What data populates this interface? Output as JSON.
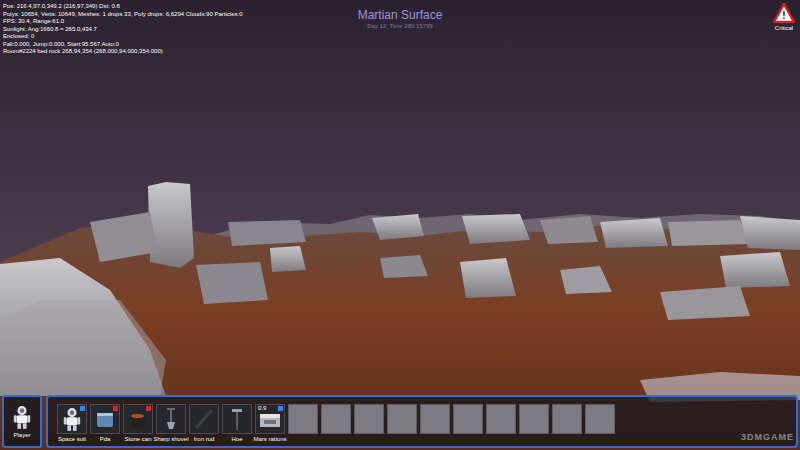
{
  "hud": {
    "debug_lines": [
      "Pos: 216.4,97.0,349.2 (216,97,349) Dst: 0.8",
      "Polys: 10654, Verts: 10649, Meshes: 1 drops 33, Poly drops: 6,6294 Clouds:90 Particles:0",
      "FPS: 30.4, Range:61.0",
      "Sunlight: Ang:1660.8 = 265.0,434.7",
      "Enclosed: 0",
      "Fall:0.000, Jump:0.000, Start:95.567 Auto:0",
      "Room#2224 bed rock 268,94,354 (268.000,94.000,354.000)"
    ],
    "location": "Martian Surface",
    "time": "Day 12, Time 289.15799",
    "alert": {
      "icon": "!",
      "label": "Critical"
    }
  },
  "player": {
    "label": "Player"
  },
  "inventory": {
    "slots": [
      {
        "kind": "suit",
        "label": "Space suit",
        "badge": "#3b82f6"
      },
      {
        "kind": "pda",
        "label": "Pda",
        "badge": "#dc2626"
      },
      {
        "kind": "can",
        "label": "Stone can",
        "badge": "#dc2626"
      },
      {
        "kind": "shovel",
        "label": "Sharp shovel"
      },
      {
        "kind": "rod",
        "label": "Iron rod"
      },
      {
        "kind": "hoe",
        "label": "Hoe"
      },
      {
        "kind": "ration",
        "label": "Mars rations",
        "count": "0.9",
        "badge": "#3b82f6"
      },
      {
        "kind": "empty"
      },
      {
        "kind": "empty"
      },
      {
        "kind": "empty"
      },
      {
        "kind": "empty"
      },
      {
        "kind": "empty"
      },
      {
        "kind": "empty"
      },
      {
        "kind": "empty"
      },
      {
        "kind": "empty"
      },
      {
        "kind": "empty"
      },
      {
        "kind": "empty"
      }
    ]
  },
  "watermark": "3DMGAME"
}
